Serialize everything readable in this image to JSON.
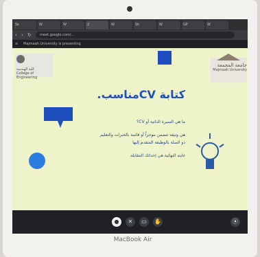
{
  "browser": {
    "tabs": [
      "Sk",
      "W",
      "W",
      "2",
      "W",
      "Sk",
      "W",
      "GP",
      "W"
    ],
    "url": "meet.google.com/..."
  },
  "meeting": {
    "presenter_label": "Majmaah University is presenting"
  },
  "slide": {
    "logo_left_ar": "كلية الهندسة",
    "logo_left_en": "College of Engineering",
    "logo_right_ar": "جامعة المجمعة",
    "logo_right_en": "Majmaah University",
    "title": "كتابة CVمناسب.",
    "line1": "ما هي السيرة الذاتية أو CV؟",
    "line2": "هي وثيقة تتضمن موجزاً أو قائمة بالخبرات والتعليم",
    "line3": "ذو الصلة بالوظيفة المتقدم إليها",
    "line4": "غايته النهائية هي إحداثك المقابلة."
  },
  "device": {
    "brand": "MacBook Air"
  }
}
